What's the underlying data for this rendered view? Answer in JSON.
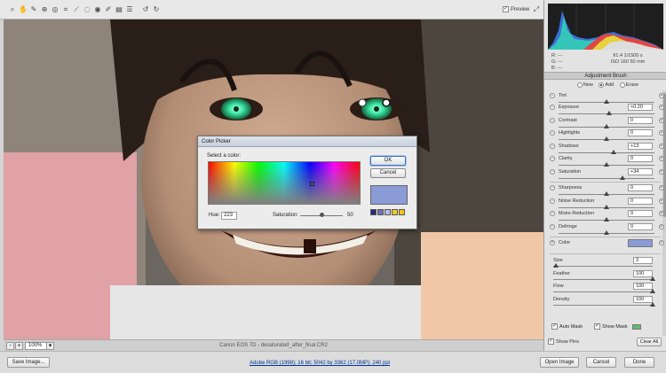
{
  "toolbar": {
    "tools": [
      "zoom-tool",
      "hand-tool",
      "white-balance-tool",
      "color-sampler-tool",
      "targeted-adjustment-tool",
      "crop-tool",
      "straighten-tool",
      "spot-removal-tool",
      "red-eye-tool",
      "adjustment-brush-tool",
      "graduated-filter-tool",
      "preferences-tool",
      "rotate-left-tool",
      "rotate-right-tool"
    ],
    "tool_glyphs": [
      "⌕",
      "✋",
      "✎",
      "⊕",
      "◎",
      "⌗",
      "⟋",
      "◌",
      "◉",
      "✐",
      "▤",
      "☰",
      "↺",
      "↻"
    ],
    "preview_label": "Preview",
    "preview_checked": true,
    "fullscreen_glyph": "⤢"
  },
  "canvas": {
    "photo_description_colors": {
      "skin": "#c8a48a",
      "hair": "#2a1e18",
      "iris": "#3ee8a6",
      "background": "#6b6660"
    }
  },
  "statusbar": {
    "zoom_minus": "-",
    "zoom_plus": "+",
    "zoom_value": "100%",
    "zoom_arrow": "▾",
    "filename": "Canon EOS 7D  -  desaturated_after_final.CR2"
  },
  "bottombar": {
    "save_label": "Save Image...",
    "workflow_link": "Adobe RGB (1998); 16 bit; 5042 by 3362 (17.0MP); 240 ppi",
    "open_label": "Open Image",
    "cancel_label": "Cancel",
    "done_label": "Done"
  },
  "panel": {
    "rgb": {
      "r": "R:   ---",
      "g": "G:   ---",
      "b": "B:   ---"
    },
    "camera": {
      "line1": "f/1.4   1/1500 s",
      "line2": "ISO 160   50 mm"
    },
    "title": "Adjustment Brush",
    "modes": {
      "new": "New",
      "add": "Add",
      "erase": "Erase",
      "selected": "add"
    },
    "sliders": [
      {
        "label": "Tint",
        "value": "",
        "pos": 0.5
      },
      {
        "label": "Exposure",
        "value": "+0.20",
        "pos": 0.53
      },
      {
        "label": "Contrast",
        "value": "0",
        "pos": 0.5
      },
      {
        "label": "Highlights",
        "value": "0",
        "pos": 0.5
      },
      {
        "label": "Shadows",
        "value": "+13",
        "pos": 0.57
      },
      {
        "label": "Clarity",
        "value": "0",
        "pos": 0.5
      },
      {
        "label": "Saturation",
        "value": "+34",
        "pos": 0.67
      },
      {
        "label": "Sharpness",
        "value": "0",
        "pos": 0.5
      },
      {
        "label": "Noise Reduction",
        "value": "0",
        "pos": 0.5
      },
      {
        "label": "Moire Reduction",
        "value": "0",
        "pos": 0.5
      },
      {
        "label": "Defringe",
        "value": "0",
        "pos": 0.5
      }
    ],
    "color_label": "Color",
    "color_value": "#8b9bd6",
    "brush": [
      {
        "label": "Size",
        "value": "3",
        "pos": 0.03
      },
      {
        "label": "Feather",
        "value": "100",
        "pos": 1.0
      },
      {
        "label": "Flow",
        "value": "100",
        "pos": 1.0
      },
      {
        "label": "Density",
        "value": "100",
        "pos": 1.0
      }
    ],
    "auto_mask": "Auto Mask",
    "auto_mask_checked": true,
    "show_mask": "Show Mask",
    "show_mask_checked": true,
    "mask_color": "#5dbb6e",
    "show_pins": "Show Pins",
    "show_pins_checked": true,
    "clear_all": "Clear All"
  },
  "dialog": {
    "title": "Color Picker",
    "select_label": "Select a color:",
    "ok_label": "OK",
    "cancel_label": "Cancel",
    "hue_label": "Hue:",
    "hue_value": "223",
    "saturation_label": "Saturation:",
    "saturation_value": "50",
    "saturation_level": 0.5,
    "selected_color": "#8b9bd6",
    "presets": [
      "#2b2b7a",
      "#6f74b4",
      "#b7bde0",
      "#e8d220",
      "#f0c418"
    ]
  }
}
